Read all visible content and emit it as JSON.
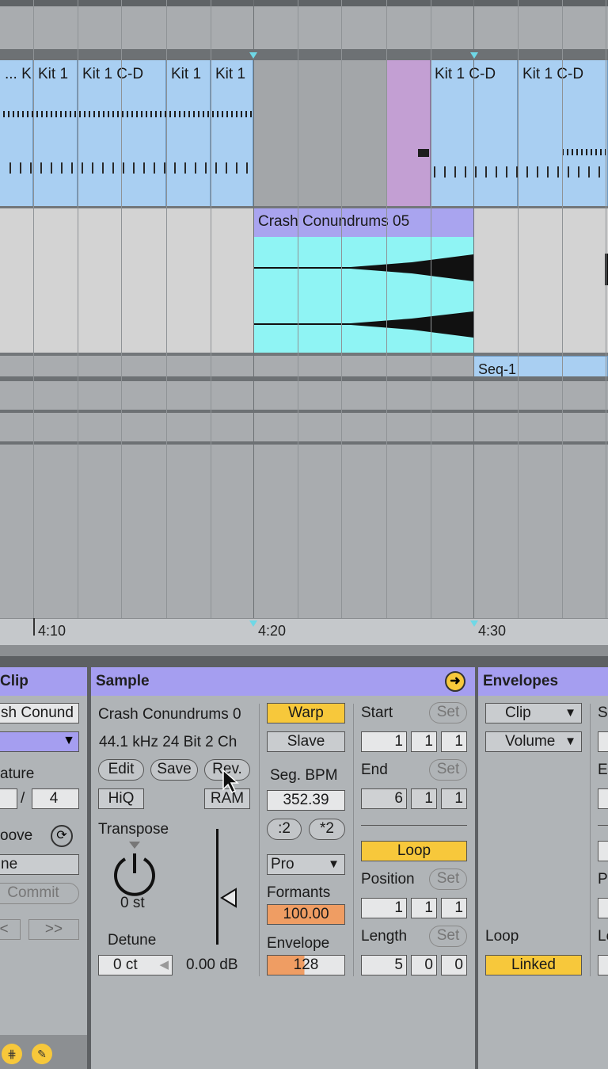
{
  "arrangement": {
    "midi_clip_titles": [
      "... K",
      "Kit 1",
      "Kit 1 C-D",
      "Kit 1",
      "Kit 1",
      "Kit 1 C-D",
      "Kit 1 C-D"
    ],
    "audio_clip_title": "Crash Conundrums 05",
    "seq_clip_title": "Seq-1",
    "ruler_labels": [
      "4:10",
      "4:20",
      "4:30"
    ],
    "colors": {
      "midi_clip": "#a9cff2",
      "audio_clip": "#8ff4f4",
      "audio_head": "#a9a4ef",
      "purple_clip": "#c39fd3"
    }
  },
  "clip_panel": {
    "title": "Clip",
    "name_value": "sh Conund",
    "signature_label": "ature",
    "signature_denominator": "4",
    "signature_slash": "/",
    "groove_label": "oove",
    "groove_value": "ne",
    "commit_label": "Commit",
    "nudge_back": "<",
    "nudge_forward": ">>"
  },
  "sample_panel": {
    "title": "Sample",
    "file_name": "Crash Conundrums 0",
    "file_info": "44.1 kHz 24 Bit 2 Ch",
    "edit_label": "Edit",
    "save_label": "Save",
    "rev_label": "Rev.",
    "hiq_label": "HiQ",
    "ram_label": "RAM",
    "transpose_label": "Transpose",
    "transpose_value": "0 st",
    "detune_label": "Detune",
    "detune_value": "0 ct",
    "gain_value": "0.00 dB",
    "warp_label": "Warp",
    "slave_label": "Slave",
    "seg_bpm_label": "Seg. BPM",
    "seg_bpm_value": "352.39",
    "half_label": ":2",
    "double_label": "*2",
    "warp_mode": "Pro",
    "formants_label": "Formants",
    "formants_value": "100.00",
    "envelope_label": "Envelope",
    "envelope_value": "128",
    "start_label": "Start",
    "start_set": "Set",
    "start_values": [
      "1",
      "1",
      "1"
    ],
    "end_label": "End",
    "end_set": "Set",
    "end_values": [
      "6",
      "1",
      "1"
    ],
    "loop_label": "Loop",
    "position_label": "Position",
    "position_set": "Set",
    "position_values": [
      "1",
      "1",
      "1"
    ],
    "length_label": "Length",
    "length_set": "Set",
    "length_values": [
      "5",
      "0",
      "0"
    ]
  },
  "envelopes_panel": {
    "title": "Envelopes",
    "clip_select": "Clip",
    "volume_select": "Volume",
    "loop_label": "Loop",
    "linked_label": "Linked",
    "clipped_labels": [
      "S",
      "E",
      "P",
      "Le"
    ]
  }
}
